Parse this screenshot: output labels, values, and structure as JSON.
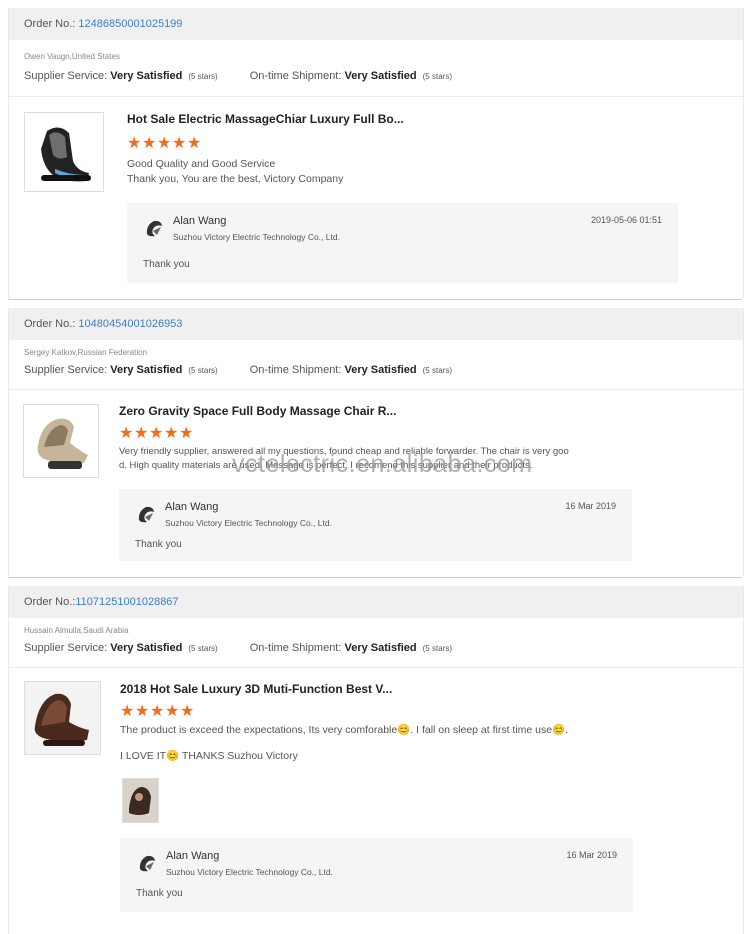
{
  "reviews": [
    {
      "order_label": "Order No.:",
      "order_number": "12486850001025199",
      "buyer": "Owen Vaugn,United States",
      "supplier_label": "Supplier Service:",
      "supplier_value": "Very Satisfied",
      "supplier_stars": "(5 stars)",
      "shipment_label": "On-time Shipment:",
      "shipment_value": "Very Satisfied",
      "shipment_stars": "(5 stars)",
      "product_title": "Hot Sale Electric MassageChiar Luxury Full Bo...",
      "rating": 5,
      "review_lines": [
        "Good Quality and Good Service",
        "Thank you, You are the best, Victory Company"
      ],
      "reply": {
        "name": "Alan Wang",
        "company": "Suzhou Victory Electric Technology Co., Ltd.",
        "date": "2019-05-06 01:51",
        "message": "Thank you"
      }
    },
    {
      "order_label": "Order No.:",
      "order_number": "10480454001026953",
      "buyer": "Sergey Katkov,Russian Federation",
      "supplier_label": "Supplier Service:",
      "supplier_value": "Very Satisfied",
      "supplier_stars": "(5 stars)",
      "shipment_label": "On-time Shipment:",
      "shipment_value": "Very Satisfied",
      "shipment_stars": "(5 stars)",
      "product_title": "Zero Gravity Space Full Body Massage Chair R...",
      "rating": 5,
      "review_lines": [
        "Very friendly supplier, answered all my questions, found cheap and reliable forwarder. The chair is very goo",
        "d. High quality materials are used. Massage is perfect. I recomend this supplier and their products."
      ],
      "reply": {
        "name": "Alan Wang",
        "company": "Suzhou Victory Electric Technology Co., Ltd.",
        "date": "16 Mar 2019",
        "message": "Thank you"
      }
    },
    {
      "order_label": "Order No.:",
      "order_number": "11071251001028867",
      "buyer": "Hussain Almulla,Saudi Arabia",
      "supplier_label": "Supplier Service:",
      "supplier_value": "Very Satisfied",
      "supplier_stars": "(5 stars)",
      "shipment_label": "On-time Shipment:",
      "shipment_value": "Very Satisfied",
      "shipment_stars": "(5 stars)",
      "product_title": "2018 Hot Sale Luxury 3D Muti-Function Best V...",
      "rating": 5,
      "review_lines": [
        "The product is exceed the expectations, Its very comforable😊. I fall on sleep at first time use😊.",
        "I LOVE IT😊  THANKS Suzhou Victory"
      ],
      "reply": {
        "name": "Alan Wang",
        "company": "Suzhou Victory Electric Technology Co., Ltd.",
        "date": "16 Mar 2019",
        "message": "Thank you"
      }
    }
  ],
  "watermark": "vctelectric.en.alibaba.com",
  "colors": {
    "accent_link": "#3c7ec8",
    "star": "#f36b1c",
    "reply_bg": "#f5f5f6"
  },
  "icons": {
    "star": "star-icon",
    "avatar": "company-logo-icon"
  }
}
